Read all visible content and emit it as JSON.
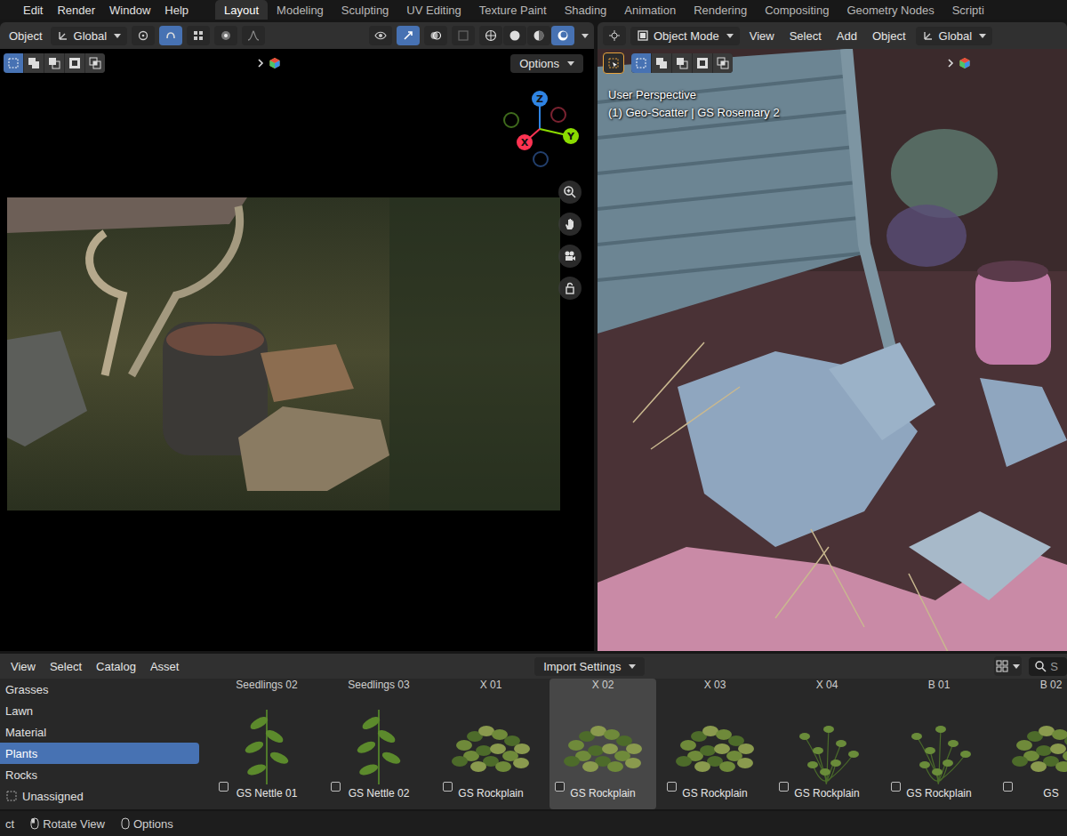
{
  "menu": [
    "Edit",
    "Render",
    "Window",
    "Help"
  ],
  "workspaces": [
    {
      "label": "Layout",
      "selected": true
    },
    {
      "label": "Modeling",
      "selected": false
    },
    {
      "label": "Sculpting",
      "selected": false
    },
    {
      "label": "UV Editing",
      "selected": false
    },
    {
      "label": "Texture Paint",
      "selected": false
    },
    {
      "label": "Shading",
      "selected": false
    },
    {
      "label": "Animation",
      "selected": false
    },
    {
      "label": "Rendering",
      "selected": false
    },
    {
      "label": "Compositing",
      "selected": false
    },
    {
      "label": "Geometry Nodes",
      "selected": false
    },
    {
      "label": "Scripti",
      "selected": false
    }
  ],
  "left_view": {
    "mode": "Object",
    "orientation": "Global",
    "options": "Options",
    "gizmo": [
      {
        "label": "Z",
        "color": "#2f84e3"
      },
      {
        "label": "Y",
        "color": "#8bdc00"
      },
      {
        "label": "X",
        "color": "#ff3352"
      }
    ]
  },
  "right_view": {
    "mode": "Object Mode",
    "menus": [
      "View",
      "Select",
      "Add",
      "Object"
    ],
    "orientation": "Global",
    "overlay": [
      "User Perspective",
      "(1) Geo-Scatter | GS Rosemary 2"
    ]
  },
  "asset_browser": {
    "menus": [
      "View",
      "Select",
      "Catalog",
      "Asset"
    ],
    "import": "Import Settings",
    "search": "S",
    "catalogs": [
      {
        "label": "Grasses",
        "kind": "catalog",
        "selected": false
      },
      {
        "label": "Lawn",
        "kind": "catalog",
        "selected": false
      },
      {
        "label": "Material",
        "kind": "catalog",
        "selected": false
      },
      {
        "label": "Plants",
        "kind": "catalog",
        "selected": true
      },
      {
        "label": "Rocks",
        "kind": "catalog",
        "selected": false
      },
      {
        "label": "Unassigned",
        "kind": "unassigned",
        "selected": false
      }
    ],
    "assets": [
      {
        "top": "Seedlings 02",
        "label": "GS Nettle 01",
        "kind": "seedling",
        "selected": false
      },
      {
        "top": "Seedlings 03",
        "label": "GS Nettle 02",
        "kind": "seedling",
        "selected": false
      },
      {
        "top": "X 01",
        "label": "GS Rockplain",
        "kind": "bush",
        "selected": false
      },
      {
        "top": "X 02",
        "label": "GS Rockplain",
        "kind": "bush",
        "selected": true
      },
      {
        "top": "X 03",
        "label": "GS Rockplain",
        "kind": "bush",
        "selected": false
      },
      {
        "top": "X 04",
        "label": "GS Rockplain",
        "kind": "sparse",
        "selected": false
      },
      {
        "top": "B 01",
        "label": "GS Rockplain",
        "kind": "sparse",
        "selected": false
      },
      {
        "top": "B 02",
        "label": "GS",
        "kind": "bush",
        "selected": false
      }
    ]
  },
  "status_bar": [
    "ct",
    "Rotate View",
    "Options"
  ]
}
